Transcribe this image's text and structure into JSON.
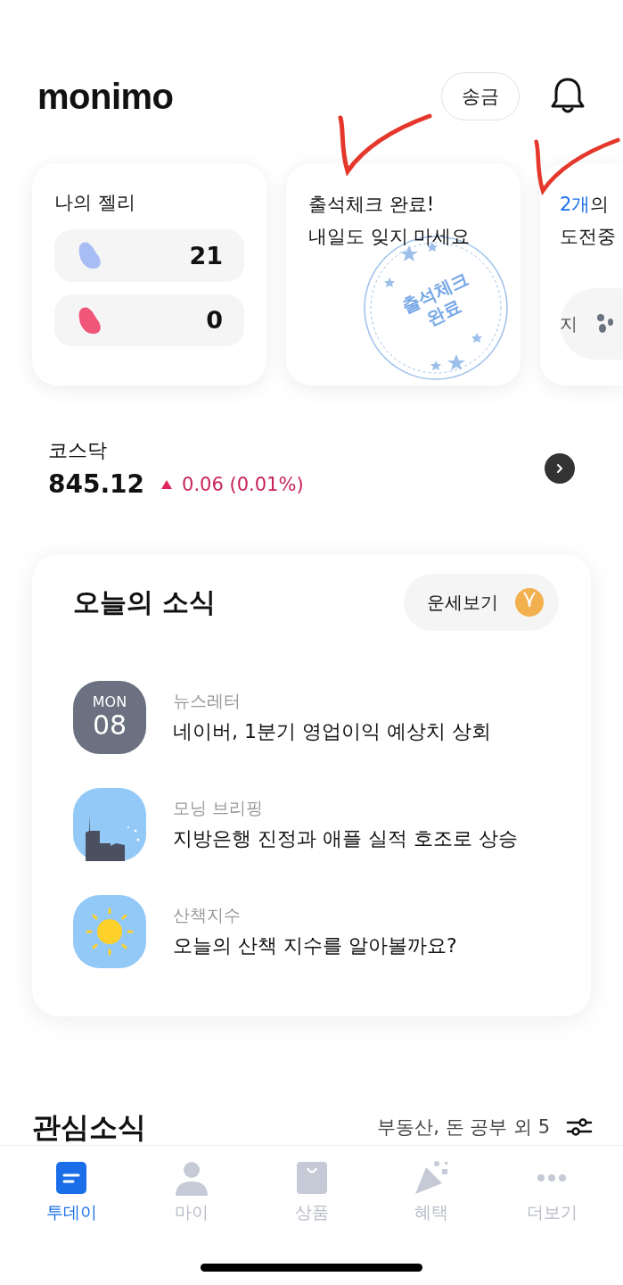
{
  "header": {
    "logo": "monimo",
    "transfer_button": "송금"
  },
  "cards": [
    {
      "kind": "jelly",
      "title": "나의 젤리",
      "rows": [
        {
          "color": "#a9bdf5",
          "count": "21"
        },
        {
          "color": "#f0557a",
          "count": "0"
        }
      ]
    },
    {
      "kind": "attendance",
      "lines": [
        "출석체크 완료!",
        "내일도 잊지 마세요"
      ],
      "stamp": [
        "출석체크",
        "완료"
      ]
    },
    {
      "kind": "challenge",
      "highlight": "2개",
      "rest": "의",
      "line2": "도전중",
      "pill": "지"
    }
  ],
  "annotations": [
    {
      "kind": "check"
    },
    {
      "kind": "check"
    }
  ],
  "index": {
    "name": "코스닥",
    "value": "845.12",
    "change": "0.06 (0.01%)"
  },
  "news": {
    "title": "오늘의 소식",
    "fortune_button": "운세보기",
    "items": [
      {
        "kind": "date",
        "day": "MON",
        "date": "08",
        "category": "뉴스레터",
        "headline": "네이버, 1분기 영업이익 예상치 상회"
      },
      {
        "kind": "city",
        "category": "모닝 브리핑",
        "headline": "지방은행 진정과 애플 실적 호조로 상승"
      },
      {
        "kind": "sun",
        "category": "산책지수",
        "headline": "오늘의 산책 지수를 알아볼까요?"
      }
    ]
  },
  "interests": {
    "title": "관심소식",
    "filter": "부동산, 돈 공부 외 5"
  },
  "nav": [
    {
      "kind": "today",
      "label": "투데이",
      "selected": true
    },
    {
      "kind": "my",
      "label": "마이",
      "selected": false
    },
    {
      "kind": "products",
      "label": "상품",
      "selected": false
    },
    {
      "kind": "benefits",
      "label": "혜택",
      "selected": false
    },
    {
      "kind": "more",
      "label": "더보기",
      "selected": false
    }
  ]
}
